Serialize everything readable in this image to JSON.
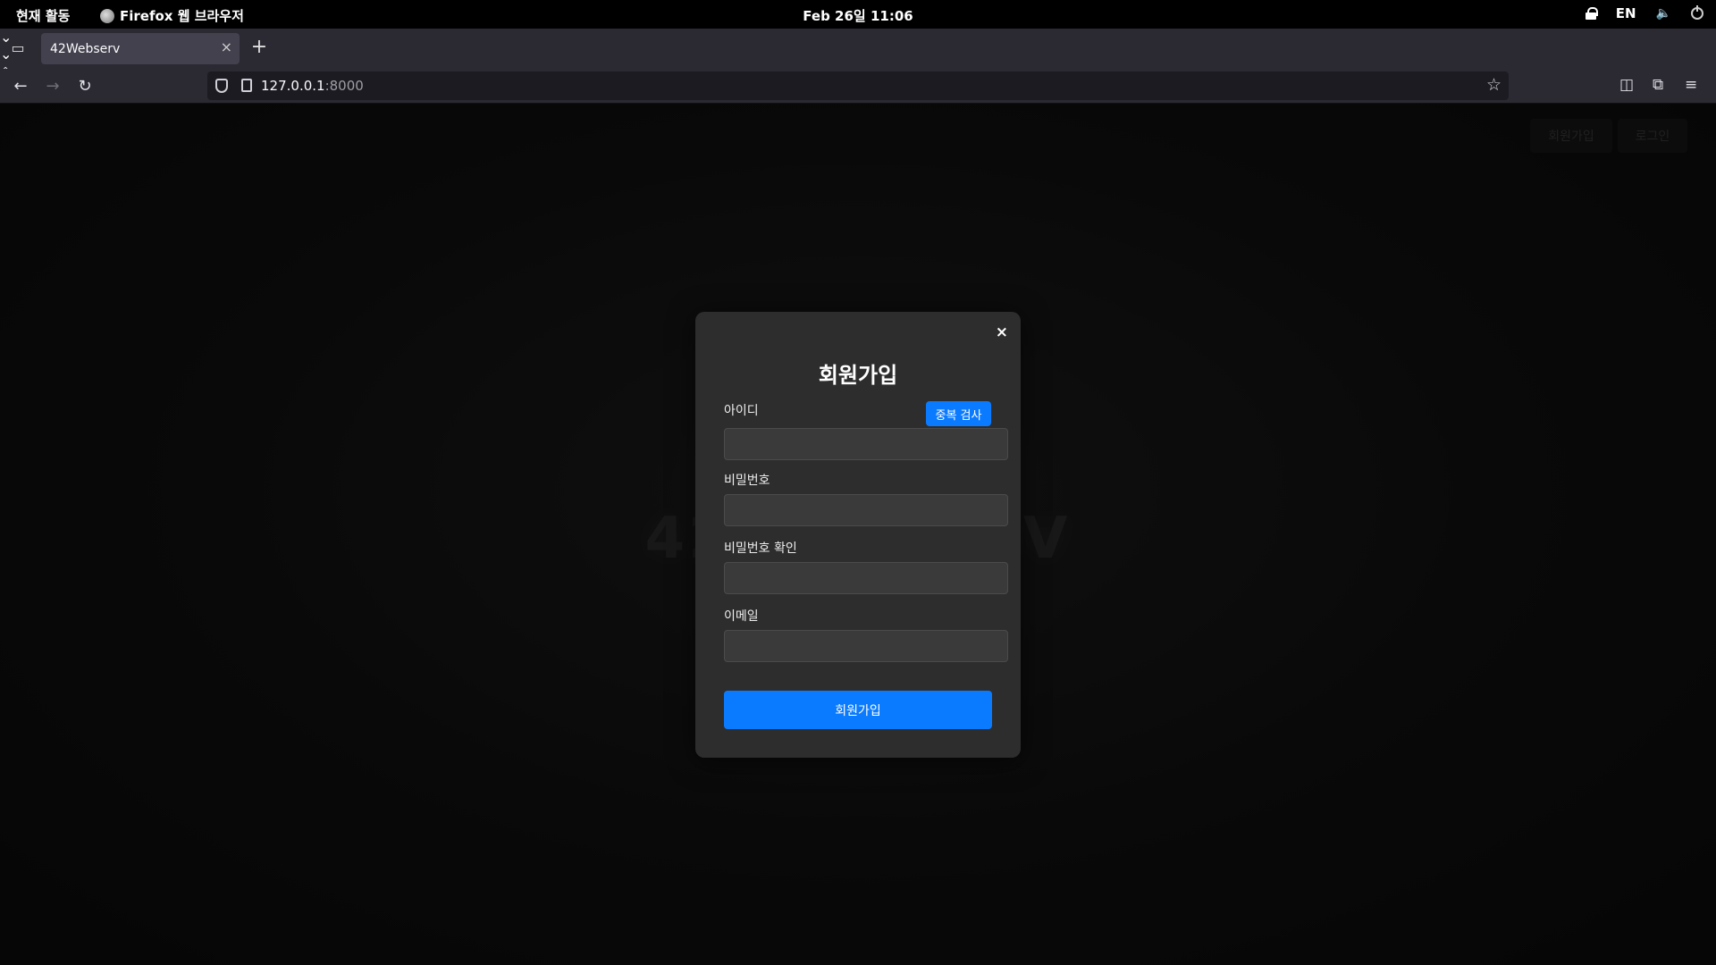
{
  "system_bar": {
    "activities": "현재 활동",
    "app_name": "Firefox 웹 브라우저",
    "clock": "Feb 26일  11:06",
    "input_method": "EN"
  },
  "browser": {
    "tab_title": "42Webserv",
    "url_host": "127.0.0.1",
    "url_port": ":8000"
  },
  "page": {
    "hero_text": "42WEBSERV",
    "signup_button": "회원가입",
    "login_button": "로그인"
  },
  "modal": {
    "close": "×",
    "title": "회원가입",
    "fields": [
      {
        "label": "아이디",
        "value": ""
      },
      {
        "label": "비밀번호",
        "value": ""
      },
      {
        "label": "비밀번호 확인",
        "value": ""
      },
      {
        "label": "이메일",
        "value": ""
      }
    ],
    "duplicate_check": "중복 검사",
    "submit": "회원가입"
  },
  "colors": {
    "accent": "#0a7bff",
    "modal_bg": "#2d2d2d",
    "browser_chrome": "#2b2a33"
  }
}
